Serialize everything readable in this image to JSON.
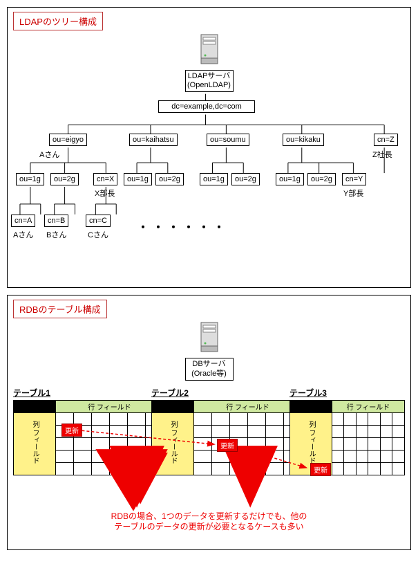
{
  "ldap": {
    "title": "LDAPのツリー構成",
    "server_label1": "LDAPサーバ",
    "server_label2": "(OpenLDAP)",
    "root": "dc=example,dc=com",
    "ou_eigyo": "ou=eigyo",
    "ou_kaihatsu": "ou=kaihatsu",
    "ou_soumu": "ou=soumu",
    "ou_kikaku": "ou=kikaku",
    "cn_z": "cn=Z",
    "ann_asan": "Aさん",
    "ann_zshacho": "Z社長",
    "ou_1g": "ou=1g",
    "ou_2g": "ou=2g",
    "cn_x": "cn=X",
    "ann_xbutyo": "X部長",
    "cn_a": "cn=A",
    "cn_b": "cn=B",
    "cn_c": "cn=C",
    "cn_y": "cn=Y",
    "ann_ybutyo": "Y部長",
    "ann_a2": "Aさん",
    "ann_b": "Bさん",
    "ann_c": "Cさん",
    "dots": "・・・・・・"
  },
  "rdb": {
    "title": "RDBのテーブル構成",
    "server_label1": "DBサーバ",
    "server_label2": "(Oracle等)",
    "table1": "テーブル1",
    "table2": "テーブル2",
    "table3": "テーブル3",
    "row_field": "行  フィールド",
    "col_field": "列 フィールド",
    "update": "更新",
    "caption1": "RDBの場合、1つのデータを更新するだけでも、他の",
    "caption2": "テーブルのデータの更新が必要となるケースも多い"
  }
}
